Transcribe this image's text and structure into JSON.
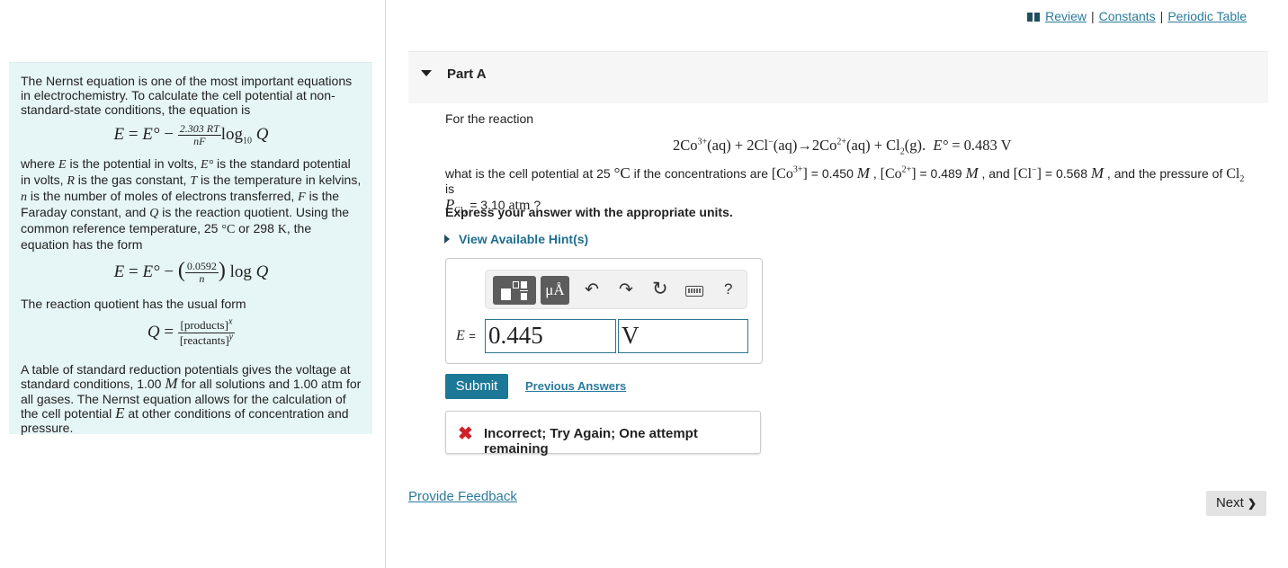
{
  "intro": {
    "p1": "The Nernst equation is one of the most important equations in electrochemistry. To calculate the cell potential at non-standard-state conditions, the equation is",
    "eq1": {
      "lhs": "E",
      "eq": " = ",
      "e0": "E°",
      "minus": " − ",
      "num": "2.303 RT",
      "den": "nF",
      "log": "log",
      "logsub": "10",
      "q": "Q"
    },
    "p2": {
      "t1": "where ",
      "E": "E",
      "t2": " is the potential in volts, ",
      "E0": "E°",
      "t3": " is the standard potential in volts, ",
      "R": "R",
      "t4": " is the gas constant, ",
      "T": "T",
      "t5": " is the temperature in kelvins, ",
      "n": "n",
      "t6": " is the number of moles of electrons transferred, ",
      "F": "F",
      "t7": " is the Faraday constant, and ",
      "Q": "Q",
      "t8": " is the reaction quotient. Using the common reference temperature, 25 ",
      "degC": "°C",
      "t9": " or 298 ",
      "K": "K",
      "t10": ", the equation has the form"
    },
    "eq2": {
      "lhs": "E",
      "eq": " = ",
      "e0": "E°",
      "minus": " − ",
      "num": "0.0592",
      "den": "n",
      "log": "log",
      "q": "Q"
    },
    "p3": "The reaction quotient has the usual form",
    "eq3": {
      "q": "Q",
      "eq": " = ",
      "num": "[products]",
      "numsup": "x",
      "den": "[reactants]",
      "densup": "y"
    },
    "p4": {
      "t1": "A table of standard reduction potentials gives the voltage at standard conditions, 1.00 ",
      "M": "M",
      "t2": " for all solutions and 1.00 ",
      "atm": "atm",
      "t3": " for all gases. The Nernst equation allows for the calculation of the cell potential ",
      "E": "E",
      "t4": " at other conditions of concentration and pressure."
    }
  },
  "top_links": {
    "review": "Review",
    "constants": "Constants",
    "periodic_table": "Periodic Table",
    "sep": "|"
  },
  "part": {
    "title": "Part A"
  },
  "question": {
    "lead": "For the reaction",
    "reaction": {
      "r1": "2Co",
      "r1sup": "3+",
      "aq": "(aq)",
      "plus": " + ",
      "r2": "2Cl",
      "r2sup": "−",
      "arrow": "→",
      "p1": "2Co",
      "p1sup": "2+",
      "p2": "Cl",
      "p2sub": "2",
      "g": "(g).",
      "e0": "E°",
      "eq": " = ",
      "value": "0.483 V"
    },
    "line": {
      "t1": "what is the cell potential at 25 ",
      "degC": "°C",
      "t2": " if the concentrations are ",
      "co3": "[Co",
      "co3sup": "3+",
      "co3end": "]",
      "v1": " = 0.450 ",
      "M": "M",
      "t3": " , ",
      "co2": "[Co",
      "co2sup": "2+",
      "co2end": "]",
      "v2": " = 0.489 ",
      "t4": " , and ",
      "cl": "[Cl",
      "clsup": "−",
      "clend": "]",
      "v3": " = 0.568 ",
      "t5": " , and the pressure of ",
      "cl2": "Cl",
      "cl2sub": "2",
      "t6": " is",
      "p": "P",
      "psub": "Cl",
      "psubsub": "2",
      "v4": " = 3.10 ",
      "atm": "atm",
      "t7": " ?"
    },
    "express": "Express your answer with the appropriate units.",
    "hint": "View Available Hint(s)"
  },
  "answer": {
    "toolbar": {
      "units": "μÅ",
      "undo": "↶",
      "redo": "↷",
      "reset": "↻",
      "help": "?"
    },
    "label": "E",
    "label_eq": "=",
    "value": "0.445",
    "unit": "V"
  },
  "actions": {
    "submit": "Submit",
    "previous_answers": "Previous Answers"
  },
  "feedback": {
    "icon": "✖",
    "message": "Incorrect; Try Again; One attempt remaining"
  },
  "footer": {
    "provide_feedback": "Provide Feedback",
    "next": "Next",
    "next_icon": "❯"
  },
  "colors": {
    "accent": "#1b7897",
    "link": "#2a7a9b",
    "error": "#d0202a",
    "intro_bg": "#e6f5f6"
  }
}
